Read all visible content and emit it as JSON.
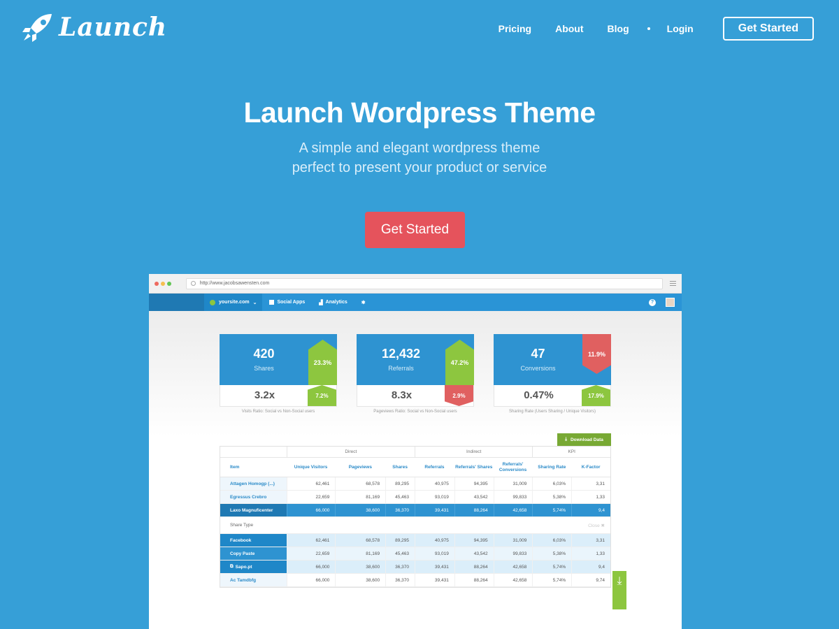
{
  "brand": {
    "name": "Launch"
  },
  "nav": {
    "links": [
      "Pricing",
      "About",
      "Blog"
    ],
    "login": "Login",
    "cta": "Get Started"
  },
  "hero": {
    "title": "Launch Wordpress Theme",
    "subtitle_line1": "A simple and elegant wordpress theme",
    "subtitle_line2": "perfect to present your product or service",
    "button": "Get Started"
  },
  "colors": {
    "background": "#369fd7",
    "cta": "#e5535c",
    "up": "#8dc63f",
    "down": "#e06060"
  },
  "mockup": {
    "url": "http://www.jacobsawensten.com",
    "appbar": {
      "site": "yoursite.com",
      "social_apps": "Social Apps",
      "analytics": "Analytics"
    },
    "cards": [
      {
        "value": "420",
        "label": "Shares",
        "change": "23.3%",
        "sub_value": "3.2x",
        "sub_change": "7.2%",
        "caption": "Visits Ratio: Social vs Non-Social users"
      },
      {
        "value": "12,432",
        "label": "Referrals",
        "change": "47.2%",
        "sub_value": "8.3x",
        "sub_change": "2.9%",
        "caption": "Pageviews Ratio: Social vs Non-Social users"
      },
      {
        "value": "47",
        "label": "Conversions",
        "change": "11.9%",
        "sub_value": "0.47%",
        "sub_change": "17.9%",
        "caption": "Sharing Rate (Users Sharing / Unique Visitors)"
      }
    ],
    "table": {
      "download": "Download Data",
      "groups": {
        "direct": "Direct",
        "indirect": "Indirect",
        "kpi": "KPI"
      },
      "headers": {
        "item": "Item",
        "unique_visitors": "Unique Visitors",
        "pageviews": "Pageviews",
        "shares": "Shares",
        "referrals": "Referrals",
        "ref_shares": "Referrals' Shares",
        "ref_conv": "Referrals' Conversions",
        "sharing_rate": "Sharing Rate",
        "kfactor": "K-Factor"
      },
      "rows": [
        [
          "Attagen Homogp (...)",
          "62,461",
          "68,578",
          "89,295",
          "40,975",
          "94,395",
          "31,009",
          "6,03%",
          "3,31"
        ],
        [
          "Egressus Crebro",
          "22,659",
          "81,169",
          "45,463",
          "93,019",
          "43,542",
          "99,833",
          "5,38%",
          "1,33"
        ],
        [
          "Laxo Magnuficenter",
          "66,000",
          "38,600",
          "36,370",
          "39,431",
          "88,264",
          "42,658",
          "5,74%",
          "9,4"
        ]
      ],
      "share_type": "Share Type",
      "close": "Close",
      "sub_rows": [
        [
          "Facebook",
          "62,461",
          "68,578",
          "89,295",
          "40,975",
          "94,395",
          "31,009",
          "6,03%",
          "3,31"
        ],
        [
          "Copy Paste",
          "22,659",
          "81,169",
          "45,463",
          "93,019",
          "43,542",
          "99,833",
          "5,38%",
          "1,33"
        ],
        [
          "Sapo.pt",
          "66,000",
          "38,600",
          "36,370",
          "39,431",
          "88,264",
          "42,658",
          "5,74%",
          "9,4"
        ]
      ],
      "last_row": [
        "Ac Tamdbfg",
        "66,000",
        "38,600",
        "36,370",
        "39,431",
        "88,264",
        "42,658",
        "5,74%",
        "9,74"
      ]
    }
  }
}
